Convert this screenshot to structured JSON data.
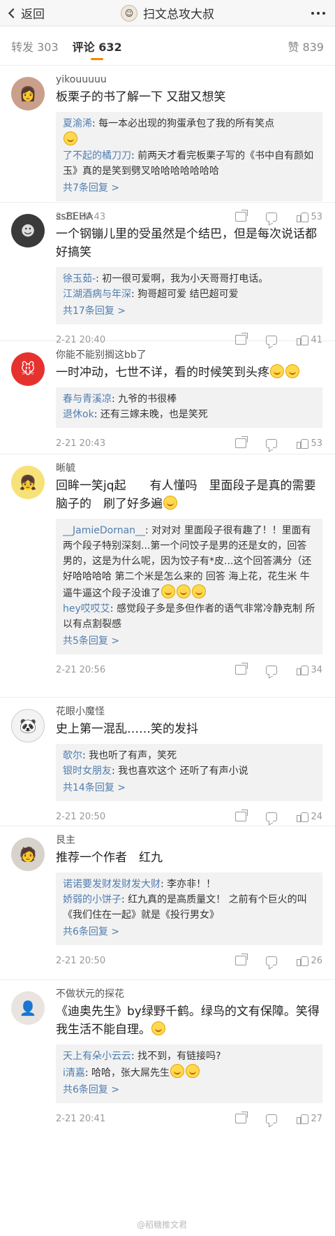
{
  "header": {
    "back_label": "返回",
    "title": "扫文总攻大叔"
  },
  "tabs": {
    "repost": "转发 303",
    "comment": "评论 632",
    "like": "赞 839"
  },
  "comments": [
    {
      "user": "yikouuuuu",
      "text": "板栗子的书了解一下 又甜又想笑",
      "replies": [
        {
          "name": "夏渝浠",
          "text": ": 每一本必出现的狗蛋承包了我的所有笑点"
        },
        {
          "name": "了不起的橘刀刀",
          "text": ": 前两天才看完板栗子写的《书中自有颜如玉》真的是笑到劈叉哈哈哈哈哈哈哈"
        }
      ],
      "more": "共7条回复 >",
      "time": "2-21 20:43",
      "likes": "53"
    },
    {
      "user": "ssBEHA",
      "text": "一个钢镚儿里的受虽然是个结巴，但是每次说话都好搞笑",
      "replies": [
        {
          "name": "徐玉茹-",
          "text": ": 初一很可爱啊，我为小天哥哥打电话。"
        },
        {
          "name": "江湖酒病与年深",
          "text": ": 狗哥超可爱 结巴超可爱"
        }
      ],
      "more": "共17条回复 >",
      "time": "2-21 20:40",
      "likes": "41"
    },
    {
      "user": "你能不能别搁这bb了",
      "text": "一时冲动，七世不详，看的时候笑到头疼",
      "replies": [
        {
          "name": "春与青溪凉",
          "text": ": 九爷的书很棒"
        },
        {
          "name": "退休ok",
          "text": ": 还有三嫁未晚，也是笑死"
        }
      ],
      "more": "",
      "time": "2-21 20:43",
      "likes": "53"
    },
    {
      "user": "晰毓",
      "text": "回眸一笑jq起　　有人懂吗　里面段子是真的需要脑子的　刷了好多遍",
      "replies": [
        {
          "name": "__JamieDornan__",
          "text": ": 对对对 里面段子很有趣了！！里面有两个段子特别深刻...第一个问饺子是男的还是女的，回答男的，这是为什么呢，因为饺子有*皮...这个回答满分（还好哈哈哈哈 第二个米是怎么来的 回答 海上花，花生米 牛逼牛逼这个段子没谁了"
        },
        {
          "name": "hey哎哎艾",
          "text": ": 感觉段子多是多但作者的语气非常冷静克制 所以有点割裂感"
        }
      ],
      "more": "共5条回复 >",
      "time": "2-21 20:56",
      "likes": "34"
    },
    {
      "user": "花眼小魔怪",
      "text": "史上第一混乱……笑的发抖",
      "replies": [
        {
          "name": "欹尔",
          "text": ": 我也听了有声，笑死"
        },
        {
          "name": "银时女朋友",
          "text": ": 我也喜欢这个 还听了有声小说"
        }
      ],
      "more": "共14条回复 >",
      "time": "2-21 20:50",
      "likes": "24"
    },
    {
      "user": "艮主",
      "text": "推荐一个作者　红九",
      "replies": [
        {
          "name": "诺诺要发财发财发大财",
          "text": ": 李亦非！！"
        },
        {
          "name": "娇弱的小饼子",
          "text": ": 红九真的是高质量文！ 之前有个巨火的叫《我们住在一起》就是《投行男女》"
        }
      ],
      "more": "共6条回复 >",
      "time": "2-21 20:50",
      "likes": "26"
    },
    {
      "user": "不做状元的探花",
      "text": "《迪奥先生》by绿野千鹤。绿鸟的文有保障。笑得我生活不能自理。",
      "replies": [
        {
          "name": "天上有朵小云云",
          "text": ": 找不到，有链接吗?"
        },
        {
          "name": "i清嘉",
          "text": ": 哈哈，张大屌先生"
        }
      ],
      "more": "共6条回复 >",
      "time": "2-21 20:41",
      "likes": "27"
    }
  ],
  "watermark": "@稻糖推文君"
}
